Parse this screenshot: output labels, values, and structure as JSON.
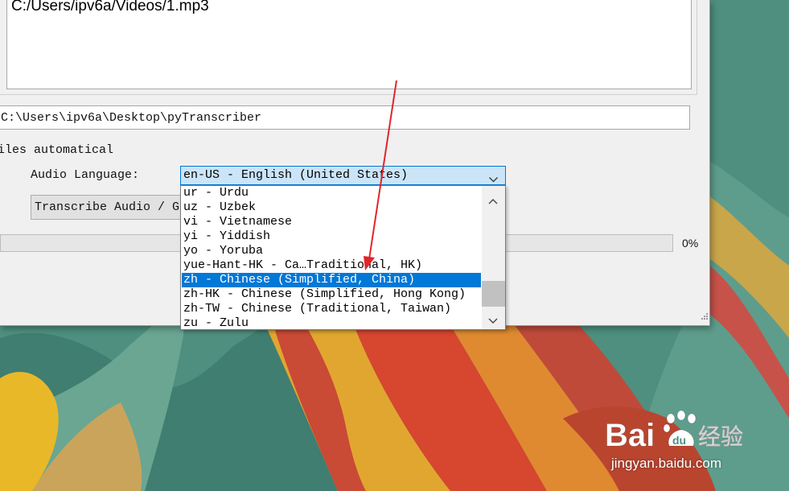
{
  "file_list": {
    "items": [
      "C:/Users/ipv6a/Videos/1.mp3"
    ]
  },
  "output_folder": {
    "value": "C:\\Users\\ipv6a\\Desktop\\pyTranscriber"
  },
  "subtitles_label": "iles automatical",
  "audio_language": {
    "label": "Audio Language:",
    "selected": "en-US - English (United States)"
  },
  "transcribe_button": {
    "label": "Transcribe Audio / Ge"
  },
  "progress": {
    "value": 0,
    "text": "0%"
  },
  "language_dropdown": {
    "options": [
      "ur - Urdu",
      "uz - Uzbek",
      "vi - Vietnamese",
      "yi - Yiddish",
      "yo - Yoruba",
      "yue-Hant-HK - Ca…Traditional, HK)",
      "zh - Chinese (Simplified, China)",
      "zh-HK - Chinese (Simplified, Hong Kong)",
      "zh-TW - Chinese (Traditional, Taiwan)",
      "zu - Zulu"
    ],
    "highlighted_index": 6
  },
  "watermark": {
    "url": "jingyan.baidu.com"
  },
  "colors": {
    "selection": "#0078d7",
    "combo_focus": "#cce4f7",
    "annotation_arrow": "#e0262a",
    "progress_fill": "#06b025"
  },
  "icons": [
    "chevron-down-icon",
    "scroll-up-icon",
    "scroll-down-icon",
    "resize-grip-icon",
    "red-arrow-annotation",
    "baidu-logo"
  ]
}
